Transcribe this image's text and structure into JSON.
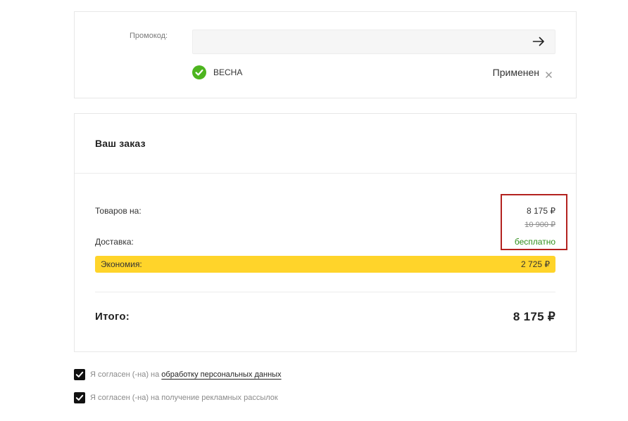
{
  "promo": {
    "label": "Промокод:",
    "input": {
      "value": ""
    },
    "submit_icon": "arrow-right-icon",
    "applied": {
      "icon": "check-circle-icon",
      "code": "ВЕСНА",
      "status": "Применен",
      "remove_icon": "close-icon"
    }
  },
  "order": {
    "title": "Ваш заказ",
    "items": {
      "label": "Товаров на:",
      "price": "8 175 ₽",
      "old_price": "10 900 ₽"
    },
    "delivery": {
      "label": "Доставка:",
      "value": "бесплатно"
    },
    "savings": {
      "label": "Экономия:",
      "value": "2 725 ₽"
    },
    "total": {
      "label": "Итого:",
      "value": "8 175 ₽"
    }
  },
  "consents": [
    {
      "checked": true,
      "text": "Я согласен (-на) на",
      "link": "обработку персональных данных"
    },
    {
      "checked": true,
      "text": "Я согласен (-на) на получение рекламных рассылок"
    }
  ],
  "colors": {
    "accent": "#FFD42A",
    "success": "#4DB51F",
    "free_delivery": "#2F8F1A",
    "highlight_frame": "#B3221F",
    "checkbox": "#111111"
  }
}
